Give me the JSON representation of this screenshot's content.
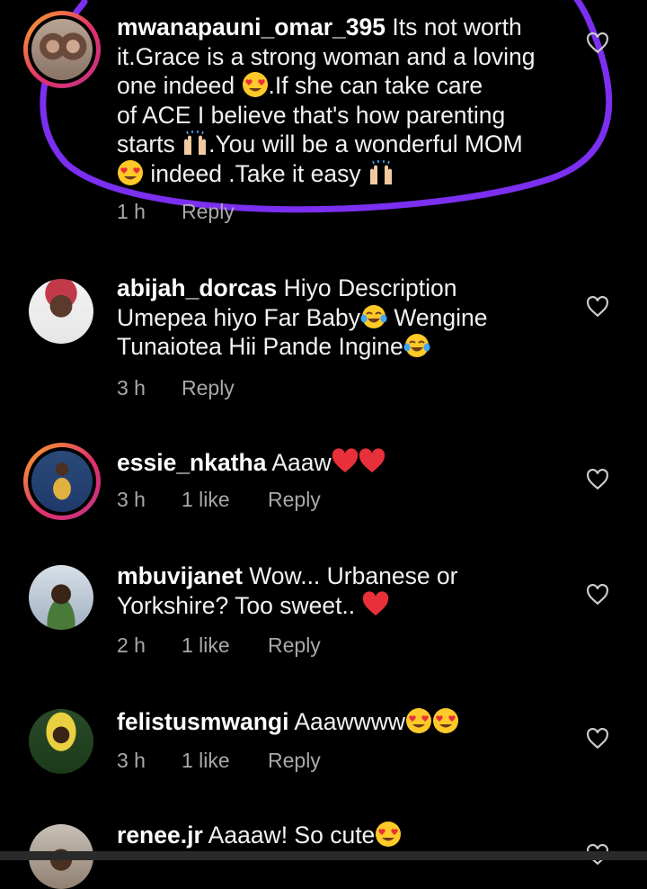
{
  "comments": [
    {
      "username": "mwanapauni_omar_395",
      "lines": [
        [
          "Its not worth"
        ],
        [
          "it.Grace is a strong woman and a loving"
        ],
        [
          "one indeed ",
          "{heart-eyes}",
          ".If she can take care"
        ],
        [
          "of ACE I believe that's how parenting"
        ],
        [
          "starts ",
          "{raising-hands}",
          ".You will be a wonderful MOM"
        ],
        [
          "{heart-eyes}",
          " indeed .Take it easy ",
          "{raising-hands}"
        ]
      ],
      "time": "1 h",
      "likes": "",
      "reply": "Reply",
      "story_ring": true
    },
    {
      "username": "abijah_dorcas",
      "lines": [
        [
          "Hiyo Description"
        ],
        [
          "Umepea hiyo Far Baby",
          "{tears-of-joy}",
          " Wengine"
        ],
        [
          "Tunaiotea Hii Pande Ingine",
          "{tears-of-joy}"
        ]
      ],
      "time": "3 h",
      "likes": "",
      "reply": "Reply",
      "story_ring": false
    },
    {
      "username": "essie_nkatha",
      "lines": [
        [
          "Aaaw",
          "{red-heart}",
          "{red-heart}"
        ]
      ],
      "time": "3 h",
      "likes": "1 like",
      "reply": "Reply",
      "story_ring": true
    },
    {
      "username": "mbuvijanet",
      "lines": [
        [
          "Wow... Urbanese or"
        ],
        [
          "Yorkshire? Too sweet.. ",
          "{red-heart}"
        ]
      ],
      "time": "2 h",
      "likes": "1 like",
      "reply": "Reply",
      "story_ring": false
    },
    {
      "username": "felistusmwangi",
      "lines": [
        [
          "Aaawwww",
          "{heart-eyes}",
          "{heart-eyes}"
        ]
      ],
      "time": "3 h",
      "likes": "1 like",
      "reply": "Reply",
      "story_ring": false
    },
    {
      "username": "renee.jr",
      "lines": [
        [
          "Aaaaw! So cute",
          "{heart-eyes}"
        ]
      ],
      "time": "",
      "likes": "",
      "reply": "",
      "story_ring": false
    }
  ],
  "icons": {
    "like": "heart-outline-icon",
    "emoji_heart_eyes": "heart-eyes-emoji",
    "emoji_tears_of_joy": "tears-of-joy-emoji",
    "emoji_raising_hands": "raising-hands-emoji",
    "emoji_red_heart": "red-heart-emoji"
  },
  "colors": {
    "background": "#000000",
    "text": "#f2f2f2",
    "meta": "#a8a8a8",
    "annotation": "#7b2ff0",
    "heart": "#e8303a"
  }
}
